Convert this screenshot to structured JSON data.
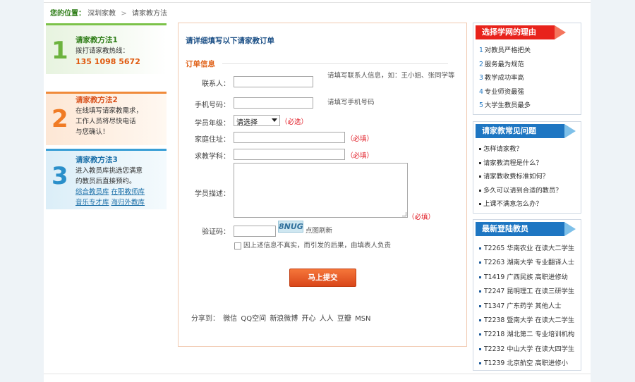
{
  "breadcrumb": {
    "label": "您的位置：",
    "home": "深圳家教",
    "separator": ">",
    "current": "请家教方法"
  },
  "methods": [
    {
      "num": "1",
      "title": "请家教方法1",
      "line1": "拨打请家教热线：",
      "phone": "135 1098 5672"
    },
    {
      "num": "2",
      "title": "请家教方法2",
      "line1": "在线填写请家教需求，",
      "line2": "工作人员将尽快电话",
      "line3": "与您确认！"
    },
    {
      "num": "3",
      "title": "请家教方法3",
      "line1": "进入教员库挑选您满意",
      "line2": "的教员后直接预约。",
      "link1": "综合教员库",
      "link2": "在职教师库",
      "link3": "音乐专才库",
      "link4": "海归外教库"
    }
  ],
  "form": {
    "heading": "请详细填写以下请家教订单",
    "section": "订单信息",
    "contact_label": "联系人：",
    "contact_hint": "请填写联系人信息，如：王小姐、张同学等",
    "phone_label": "手机号码：",
    "phone_hint": "请填写手机号码",
    "grade_label": "学员年级：",
    "grade_selected": "请选择",
    "required": "（必选）",
    "address_label": "家庭住址：",
    "subject_label": "求教学科：",
    "required_fill": "（必填）",
    "desc_label": "学员描述：",
    "captcha_label": "验证码：",
    "captcha_image_text": "8NUG",
    "captcha_refresh": "点图刷新",
    "agree_text": "因上述信息不真实，而引发的后果，由填表人负责",
    "submit_label": "马上提交"
  },
  "share": {
    "label": "分享到：",
    "items": [
      "微信",
      "QQ空间",
      "新浪微博",
      "开心",
      "人人",
      "豆瓣",
      "MSN"
    ]
  },
  "reasons": {
    "title": "选择学网的理由",
    "items": [
      "对教员严格把关",
      "服务最为规范",
      "教学成功率高",
      "专业师资最强",
      "大学生教员最多"
    ]
  },
  "faq": {
    "title": "请家教常见问题",
    "items": [
      "怎样请家教？",
      "请家教流程是什么？",
      "请家教收费标准如何？",
      "多久可以请到合适的教员？",
      "上课不满意怎么办？"
    ]
  },
  "latest": {
    "title": "最新登陆教员",
    "items": [
      "T2265 华南农业 在读大二学生",
      "T2263 湖南大学 专业翻译人士",
      "T1419 广西民族 高职进修幼",
      "T2247 昆明理工 在读三研学生",
      "T1347 广东药学 其他人士",
      "T2238 暨南大学 在读大二学生",
      "T2218 湖北第二 专业培训机构",
      "T2232 中山大学 在读大四学生",
      "T1239 北京航空 高职进修小"
    ]
  },
  "colors": {
    "accent_blue": "#1e76c2",
    "accent_orange": "#e0641c",
    "red": "#e8231c",
    "green": "#2e7d17"
  }
}
